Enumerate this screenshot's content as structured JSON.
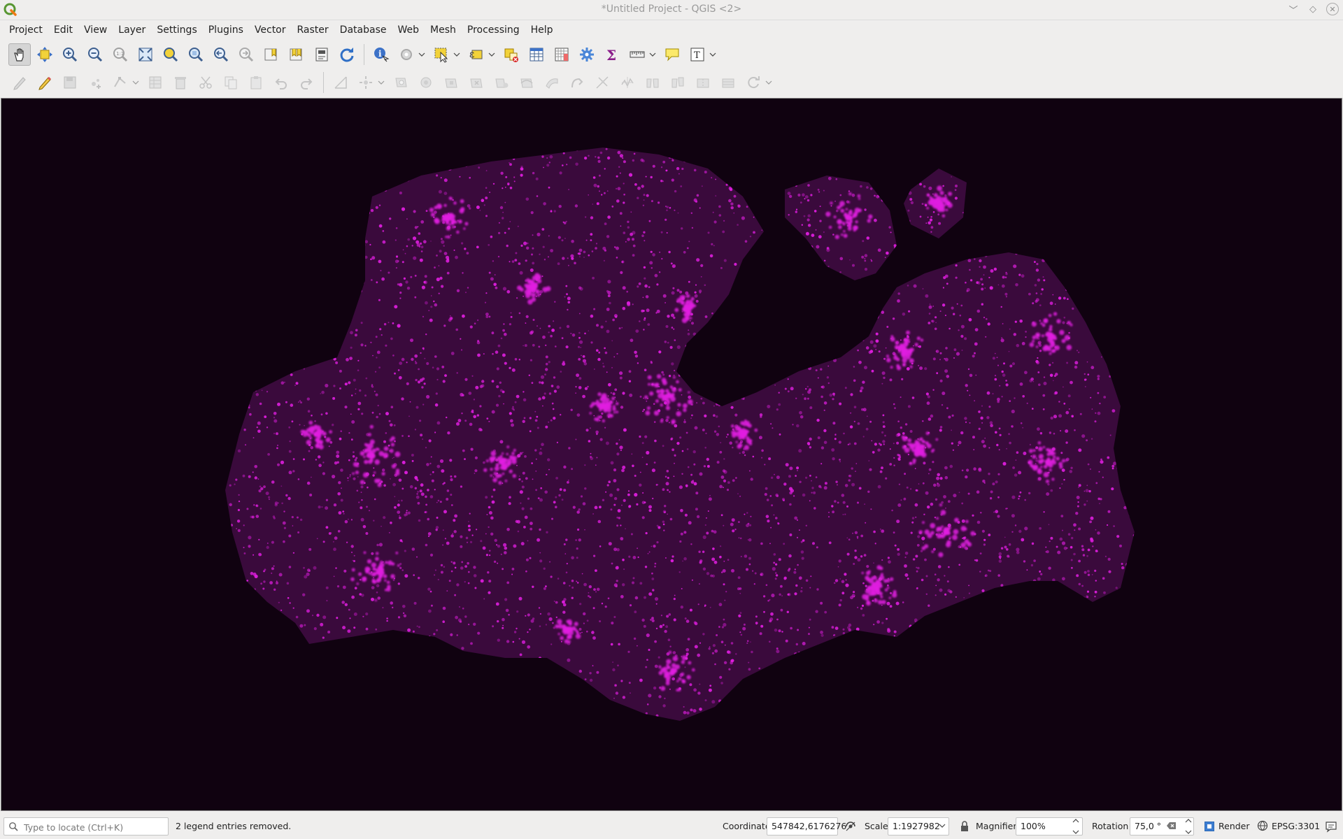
{
  "window": {
    "title": "*Untitled Project - QGIS <2>",
    "controls": [
      "minimize-icon",
      "maximize-icon",
      "close-icon"
    ]
  },
  "menu": [
    "Project",
    "Edit",
    "View",
    "Layer",
    "Settings",
    "Plugins",
    "Vector",
    "Raster",
    "Database",
    "Web",
    "Mesh",
    "Processing",
    "Help"
  ],
  "toolbar": {
    "navigation": [
      "pan-icon",
      "pan-to-selection-icon",
      "zoom-in-icon",
      "zoom-out-icon",
      "zoom-native-icon",
      "zoom-full-icon",
      "zoom-to-selection-icon",
      "zoom-to-layer-icon",
      "zoom-last-icon",
      "zoom-next-icon",
      "new-bookmark-icon",
      "show-bookmarks-icon",
      "temporal-controller-icon",
      "refresh-icon"
    ],
    "attributes": [
      "identify-icon",
      "actions-icon",
      "select-features-icon",
      "deselect-icon",
      "deselect-all-icon",
      "attribute-table-icon",
      "field-calculator-icon",
      "toolbox-icon",
      "statistics-icon",
      "measure-icon",
      "map-tips-icon",
      "text-annotation-icon"
    ],
    "digitizing": [
      "toggle-editing-icon",
      "current-edits-icon",
      "save-edits-icon",
      "add-feature-icon",
      "vertex-tool-icon",
      "modify-attributes-icon",
      "delete-selected-icon",
      "cut-features-icon",
      "copy-features-icon",
      "paste-features-icon",
      "undo-icon",
      "redo-icon"
    ]
  },
  "map": {
    "background": "#100210",
    "point_color": "#e01ee0",
    "description_layer": "point density layer"
  },
  "statusbar": {
    "locator_placeholder": "Type to locate (Ctrl+K)",
    "message": "2 legend entries removed.",
    "coordinate_label": "Coordinate",
    "coordinate_value": "547842,6176276",
    "scale_label": "Scale",
    "scale_value": "1:1927982",
    "magnifier_label": "Magnifier",
    "magnifier_value": "100%",
    "rotation_label": "Rotation",
    "rotation_value": "75,0 °",
    "render_label": "Render",
    "render_checked": true,
    "crs": "EPSG:3301"
  }
}
